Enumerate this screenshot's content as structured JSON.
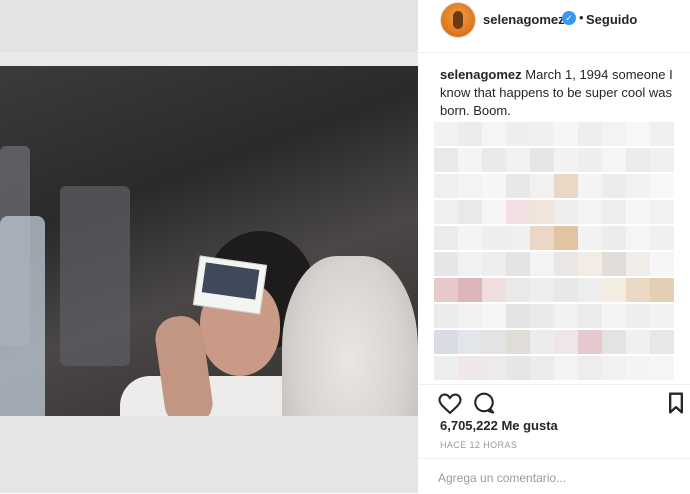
{
  "post": {
    "username": "selenagomez",
    "verified_badge": "✓",
    "separator": "•",
    "follow_status": "Seguido",
    "caption_user": "selenagomez",
    "caption_text": " March 1, 1994 someone I know that happens to be super cool was born. Boom.",
    "likes": "6,705,222 Me gusta",
    "time_ago": "HACE 12 HORAS",
    "comment_placeholder": "Agrega un comentario..."
  },
  "icons": {
    "like": "heart-icon",
    "comment": "comment-icon",
    "save": "bookmark-icon"
  },
  "colors": {
    "verified": "#3897f0",
    "text": "#262626",
    "muted": "#999999"
  },
  "mosaic_colors": [
    "#f2f2f2",
    "#ececec",
    "#f5f5f5",
    "#eeeeee",
    "#f0f0f0",
    "#f6f6f6",
    "#ededed",
    "#f3f3f3",
    "#f7f7f7",
    "#efefef",
    "#e9e9e9",
    "#f4f4f4",
    "#eaeaea",
    "#f1f1f1",
    "#e6e6e6",
    "#f2f2f2",
    "#eeeeee",
    "#f5f5f5",
    "#ebebeb",
    "#f0f0f0",
    "#efefef",
    "#f3f3f3",
    "#f6f6f6",
    "#e8e8e8",
    "#f1f1f1",
    "#ead7c6",
    "#f4f4f4",
    "#ececec",
    "#f2f2f2",
    "#f7f7f7",
    "#f0f0f0",
    "#e9e9e9",
    "#f5f5f5",
    "#f3e0e3",
    "#f1e5db",
    "#eeeeee",
    "#f3f3f3",
    "#ededed",
    "#f6f6f6",
    "#f1f1f1",
    "#ebebeb",
    "#f4f4f4",
    "#eeeeee",
    "#efefef",
    "#ead7c6",
    "#e2c4a3",
    "#f2f2f2",
    "#ececec",
    "#f5f5f5",
    "#f0f0f0",
    "#e6e6e6",
    "#f1f1f1",
    "#eeeeee",
    "#e4e4e4",
    "#f3f3f3",
    "#eae6e3",
    "#f3ece4",
    "#e1ddd9",
    "#f0ede8",
    "#f6f6f6",
    "#e8c9c9",
    "#dcb6ba",
    "#f0dede",
    "#e9e9e9",
    "#eeeeee",
    "#e8e8e8",
    "#ededed",
    "#f3ece1",
    "#ead9c4",
    "#e5cfb2",
    "#ececec",
    "#f2f2f2",
    "#f5f5f5",
    "#e3e3e3",
    "#e9e9e9",
    "#f1f1f1",
    "#ebebeb",
    "#f4f4f4",
    "#eeeeee",
    "#f2f2f2",
    "#d9dde3",
    "#e2e5ea",
    "#e4e4e4",
    "#e0dcd8",
    "#ececec",
    "#efe6e8",
    "#e6c9cf",
    "#e3e3e3",
    "#f0f0f0",
    "#e7e7e7",
    "#eeeeee",
    "#f0e8e8",
    "#eee9ea",
    "#e6e6e6",
    "#ececec",
    "#f3f3f3",
    "#ededed",
    "#f1f1f1",
    "#f4f4f4",
    "#f6f6f6"
  ]
}
